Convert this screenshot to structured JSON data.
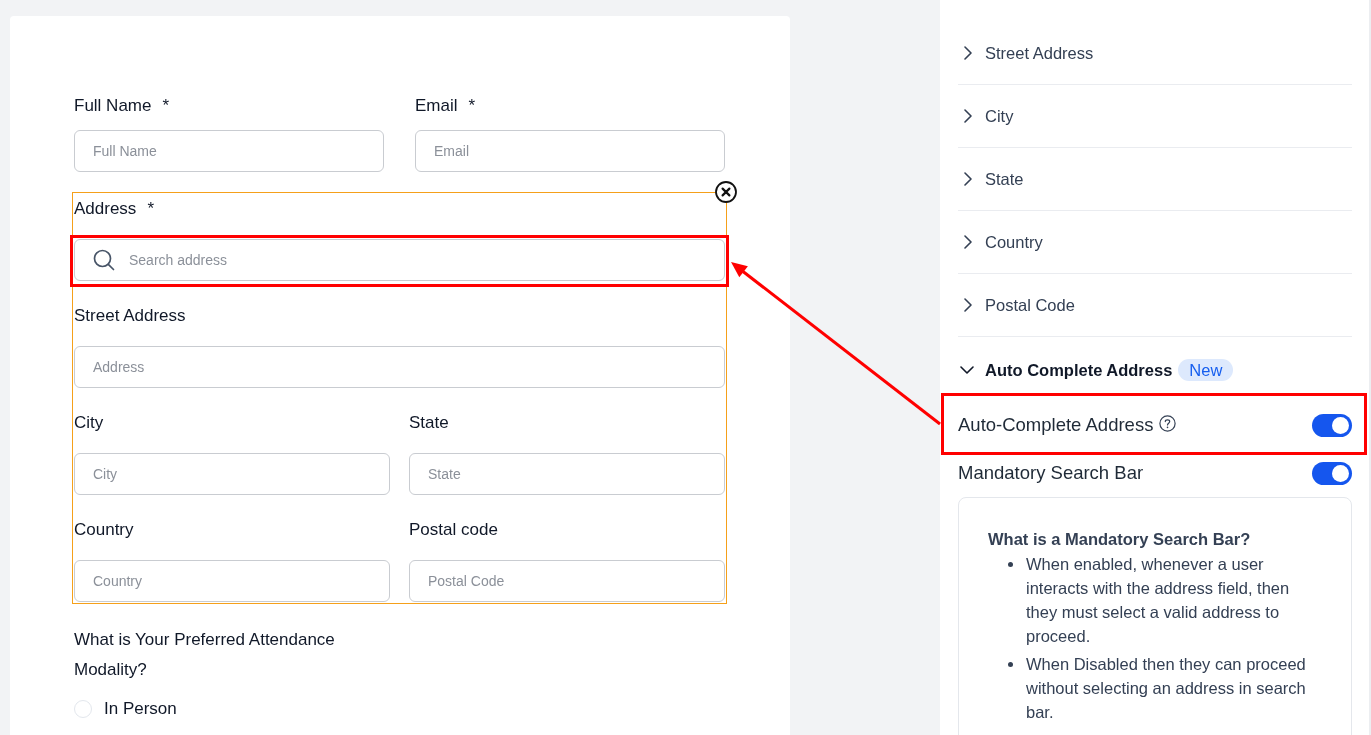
{
  "form": {
    "contact_fields": [
      {
        "label": "Full Name",
        "required_mark": "*",
        "placeholder": "Full Name"
      },
      {
        "label": "Email",
        "required_mark": "*",
        "placeholder": "Email"
      }
    ],
    "address": {
      "selected": true,
      "label": "Address",
      "required_mark": "*",
      "search": {
        "placeholder": "Search address",
        "highlighted": true
      },
      "fields": [
        {
          "kind": "wide",
          "label": "Street Address",
          "placeholder": "Address"
        },
        {
          "kind": "half",
          "label": "City",
          "placeholder": "City"
        },
        {
          "kind": "half",
          "label": "State",
          "placeholder": "State"
        },
        {
          "kind": "half",
          "label": "Country",
          "placeholder": "Country"
        },
        {
          "kind": "half",
          "label": "Postal code",
          "placeholder": "Postal Code"
        }
      ]
    },
    "question": {
      "label": "What is Your Preferred Attendance Modality?",
      "options": [
        {
          "label": "In Person",
          "selected": false
        }
      ]
    }
  },
  "settings": {
    "sections": [
      {
        "title": "Street Address",
        "expanded": false
      },
      {
        "title": "City",
        "expanded": false
      },
      {
        "title": "State",
        "expanded": false
      },
      {
        "title": "Country",
        "expanded": false
      },
      {
        "title": "Postal Code",
        "expanded": false
      },
      {
        "title": "Auto Complete Address",
        "badge": "New",
        "expanded": true,
        "toggles": [
          {
            "label": "Auto-Complete Address",
            "help": true,
            "on": true,
            "highlighted": true
          },
          {
            "label": "Mandatory Search Bar",
            "on": true
          }
        ],
        "info": {
          "title": "What is a Mandatory Search Bar?",
          "items": [
            "When enabled, whenever a user interacts with the address field, then they must select a valid address to proceed.",
            "When Disabled then they can proceed without selecting an address in search bar."
          ]
        }
      }
    ]
  }
}
